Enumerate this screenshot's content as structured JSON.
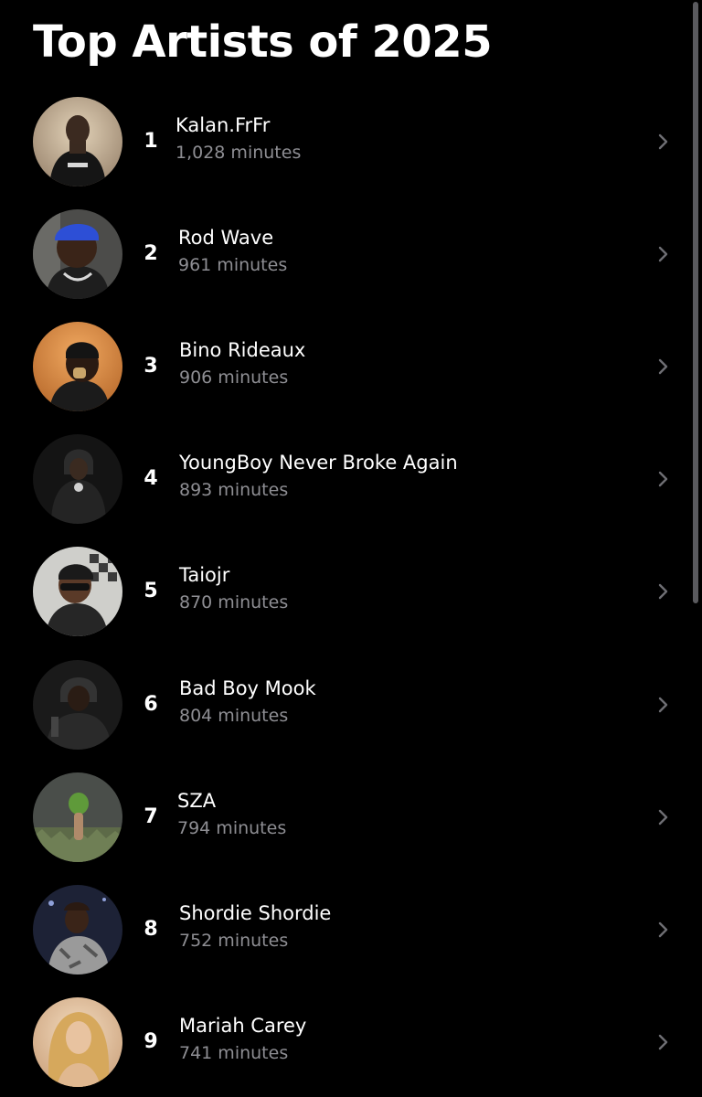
{
  "page": {
    "title": "Top Artists of 2025"
  },
  "artists": [
    {
      "rank": "1",
      "name": "Kalan.FrFr",
      "minutes": "1,028 minutes"
    },
    {
      "rank": "2",
      "name": "Rod Wave",
      "minutes": "961 minutes"
    },
    {
      "rank": "3",
      "name": "Bino Rideaux",
      "minutes": "906 minutes"
    },
    {
      "rank": "4",
      "name": "YoungBoy Never Broke Again",
      "minutes": "893 minutes"
    },
    {
      "rank": "5",
      "name": "Taiojr",
      "minutes": "870 minutes"
    },
    {
      "rank": "6",
      "name": "Bad Boy Mook",
      "minutes": "804 minutes"
    },
    {
      "rank": "7",
      "name": "SZA",
      "minutes": "794 minutes"
    },
    {
      "rank": "8",
      "name": "Shordie Shordie",
      "minutes": "752 minutes"
    },
    {
      "rank": "9",
      "name": "Mariah Carey",
      "minutes": "741 minutes"
    }
  ],
  "icons": {
    "row_action": "chevron-right-icon",
    "avatar": "artist-photo"
  },
  "colors": {
    "background": "#000000",
    "primary_text": "#ffffff",
    "secondary_text": "#8e8e93",
    "chevron": "#6e6e73"
  }
}
